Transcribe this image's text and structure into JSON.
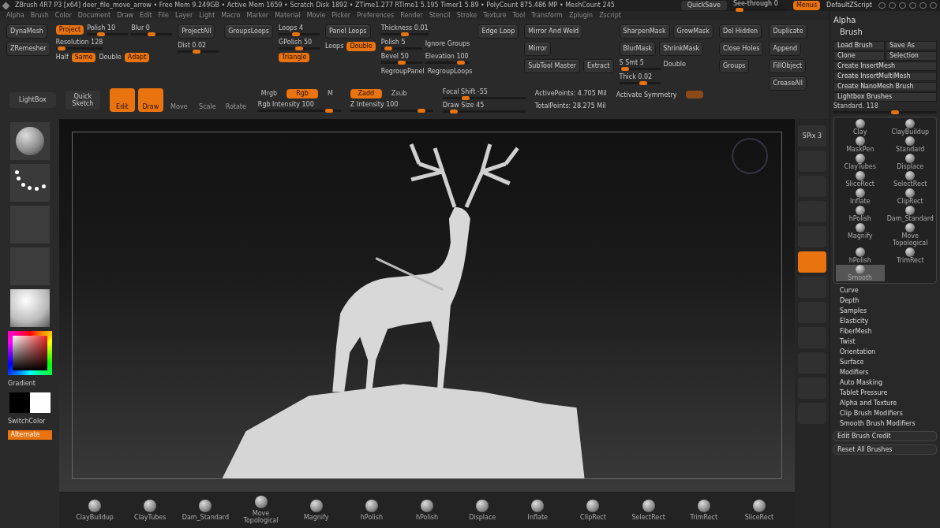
{
  "title_bar": {
    "text": "ZBrush 4R7 P3 [x64]   deer_file_move_arrow   • Free Mem 9.249GB • Active Mem 1659 • Scratch Disk 1892 • ZTime1.277 RTime1 5.195 Timer1 5.89 • PolyCount 875.486 MP • MeshCount 245",
    "quicksave": "QuickSave",
    "see_through": {
      "label": "See-through 0",
      "level": 0.05
    },
    "menus": {
      "label": "Menus",
      "on": true
    },
    "script": "DefaultZScript"
  },
  "menu_bar": [
    "Alpha",
    "Brush",
    "Color",
    "Document",
    "Draw",
    "Edit",
    "File",
    "Layer",
    "Light",
    "Macro",
    "Marker",
    "Material",
    "Movie",
    "Picker",
    "Preferences",
    "Render",
    "Stencil",
    "Stroke",
    "Texture",
    "Tool",
    "Transform",
    "Zplugin",
    "Zscript"
  ],
  "top_shelf": [
    [
      [
        {
          "kind": "button",
          "label": "DynaMesh"
        }
      ],
      [
        {
          "kind": "button",
          "label": "ZRemesher"
        }
      ]
    ],
    [
      [
        {
          "kind": "toggle",
          "label": "Project",
          "on": true
        },
        {
          "kind": "slider",
          "label": "Polish 10",
          "level": 0.3
        },
        {
          "kind": "slider",
          "label": "Blur 0",
          "level": 0.5
        }
      ],
      [
        {
          "kind": "slider",
          "label": "Resolution 128",
          "level": 0.05
        }
      ],
      [
        {
          "kind": "label",
          "label": "Half"
        },
        {
          "kind": "toggle",
          "label": "Same",
          "on": true
        },
        {
          "kind": "label",
          "label": "Double"
        },
        {
          "kind": "toggle",
          "label": "Adapt",
          "on": true
        }
      ]
    ],
    [
      [
        {
          "kind": "button",
          "label": "ProjectAll"
        }
      ],
      [
        {
          "kind": "slider",
          "label": "Dist 0.02",
          "level": 0.45
        }
      ]
    ],
    [
      [
        {
          "kind": "button",
          "label": "GroupsLoops"
        }
      ]
    ],
    [
      [
        {
          "kind": "slider",
          "label": "Loops 4",
          "level": 0.4
        }
      ],
      [
        {
          "kind": "slider",
          "label": "GPolish 50",
          "level": 0.5
        }
      ],
      [
        {
          "kind": "toggle",
          "label": "Triangle",
          "on": true
        }
      ]
    ],
    [
      [
        {
          "kind": "button",
          "label": "Panel Loops"
        }
      ],
      [
        {
          "kind": "label",
          "label": "Loops"
        },
        {
          "kind": "toggle",
          "label": "Double",
          "on": true
        }
      ]
    ],
    [
      [
        {
          "kind": "slider",
          "label": "Thickness 0.01",
          "level": 0.5
        }
      ],
      [
        {
          "kind": "slider",
          "label": "Polish 5",
          "level": 0.1
        },
        {
          "kind": "label",
          "label": "Ignore Groups"
        }
      ],
      [
        {
          "kind": "slider",
          "label": "Bevel 50",
          "level": 0.5
        },
        {
          "kind": "slider",
          "label": "Elevation 100",
          "level": 0.9
        }
      ],
      [
        {
          "kind": "label",
          "label": "RegroupPanel"
        },
        {
          "kind": "label",
          "label": "RegroupLoops"
        }
      ]
    ],
    [
      [
        {
          "kind": "button",
          "label": "Edge Loop"
        }
      ]
    ],
    [
      [
        {
          "kind": "button",
          "label": "Mirror And Weld"
        }
      ],
      [
        {
          "kind": "button",
          "label": "Mirror"
        }
      ],
      [
        {
          "kind": "button",
          "label": "SubTool Master"
        },
        {
          "kind": "button",
          "label": "Extract"
        }
      ]
    ],
    [
      [
        {
          "kind": "button",
          "label": "SharpenMask"
        },
        {
          "kind": "button",
          "label": "GrowMask"
        }
      ],
      [
        {
          "kind": "button",
          "label": "BlurMask"
        },
        {
          "kind": "button",
          "label": "ShrinkMask"
        }
      ],
      [
        {
          "kind": "slider",
          "label": "S Smt 5",
          "level": 0.05
        },
        {
          "kind": "label",
          "label": "Double"
        }
      ],
      [
        {
          "kind": "slider",
          "label": "Thick 0.02",
          "level": 0.6
        }
      ]
    ],
    [
      [
        {
          "kind": "button",
          "label": "Del Hidden"
        }
      ],
      [
        {
          "kind": "button",
          "label": "Close Holes"
        }
      ],
      [
        {
          "kind": "button",
          "label": "Groups"
        }
      ]
    ],
    [
      [
        {
          "kind": "button",
          "label": "Duplicate"
        }
      ],
      [
        {
          "kind": "button",
          "label": "Append"
        }
      ],
      [
        {
          "kind": "button",
          "label": "FillObject"
        }
      ],
      [
        {
          "kind": "button",
          "label": "CreaseAll"
        }
      ]
    ]
  ],
  "draw_shelf": {
    "lightbox": "LightBox",
    "quick_sketch": "Quick Sketch",
    "modes": [
      {
        "label": "Edit",
        "selected": true
      },
      {
        "label": "Draw",
        "selected": true
      },
      {
        "label": "Move",
        "selected": false
      },
      {
        "label": "Scale",
        "selected": false
      },
      {
        "label": "Rotate",
        "selected": false
      }
    ],
    "rgb": [
      {
        "label": "Mrgb",
        "selected": false
      },
      {
        "label": "Rgb",
        "selected": true
      },
      {
        "label": "M",
        "selected": false
      }
    ],
    "rgb_intensity": {
      "label": "Rgb Intensity 100",
      "level": 0.9
    },
    "z": [
      {
        "label": "Zadd",
        "selected": true
      },
      {
        "label": "Zsub",
        "selected": false
      }
    ],
    "z_intensity": {
      "label": "Z Intensity 100",
      "level": 0.9
    },
    "focal_shift": {
      "label": "Focal Shift -55",
      "level": 0.25
    },
    "draw_size": {
      "label": "Draw Size 45",
      "level": 0.1
    },
    "active_points": "ActivePoints: 4.705 Mil",
    "total_points": "TotalPoints: 28.275 Mil",
    "symmetry": "Activate Symmetry"
  },
  "left_tray": {
    "gradient": "Gradient",
    "switch_color": "SwitchColor",
    "alternate": {
      "label": "Alternate",
      "on": true
    }
  },
  "view_strip": [
    {
      "label": "SPix 3",
      "on": false
    },
    {
      "on": false
    },
    {
      "on": false
    },
    {
      "on": false
    },
    {
      "on": false
    },
    {
      "on": true
    },
    {
      "on": false
    },
    {
      "on": false
    },
    {
      "on": false
    },
    {
      "on": false
    },
    {
      "on": false
    },
    {
      "on": false
    }
  ],
  "right_panel": {
    "alpha": "Alpha",
    "brush": "Brush",
    "buttons": [
      [
        "Load Brush",
        "Save As"
      ],
      [
        "Clone",
        "Selection"
      ],
      [
        "Create InsertMesh"
      ],
      [
        "Create InsertMultiMesh"
      ],
      [
        "Create NanoMesh Brush"
      ],
      [
        "Lightbox Brushes"
      ]
    ],
    "current": {
      "label": "Standard. 118",
      "level": 0.6
    },
    "brushes": [
      {
        "name": "Clay",
        "selected": false
      },
      {
        "name": "ClayBuildup",
        "selected": false
      },
      {
        "name": "MaskPen",
        "selected": false
      },
      {
        "name": "Standard",
        "selected": false
      },
      {
        "name": "ClayTubes",
        "selected": false
      },
      {
        "name": "Displace",
        "selected": false
      },
      {
        "name": "SliceRect",
        "selected": false
      },
      {
        "name": "SelectRect",
        "selected": false
      },
      {
        "name": "Inflate",
        "selected": false
      },
      {
        "name": "ClipRect",
        "selected": false
      },
      {
        "name": "hPolish",
        "selected": false
      },
      {
        "name": "Dam_Standard",
        "selected": false
      },
      {
        "name": "Magnify",
        "selected": false
      },
      {
        "name": "Move Topological",
        "selected": false
      },
      {
        "name": "hPolish",
        "selected": false
      },
      {
        "name": "TrimRect",
        "selected": false
      },
      {
        "name": "Smooth",
        "selected": true
      }
    ],
    "sections": [
      "Curve",
      "Depth",
      "Samples",
      "Elasticity",
      "FiberMesh",
      "Twist",
      "Orientation",
      "Surface",
      "Modifiers",
      "Auto Masking",
      "Tablet Pressure",
      "Alpha and Texture",
      "Clip Brush Modifiers",
      "Smooth Brush Modifiers"
    ],
    "footer_buttons": [
      "Edit Brush Credit",
      "Reset All Brushes"
    ]
  },
  "bottom_strip": [
    "ClayBuildup",
    "ClayTubes",
    "Dam_Standard",
    "Move Topological",
    "Magnify",
    "hPolish",
    "hPolish",
    "Displace",
    "Inflate",
    "ClipRect",
    "SelectRect",
    "TrimRect",
    "SliceRect"
  ]
}
